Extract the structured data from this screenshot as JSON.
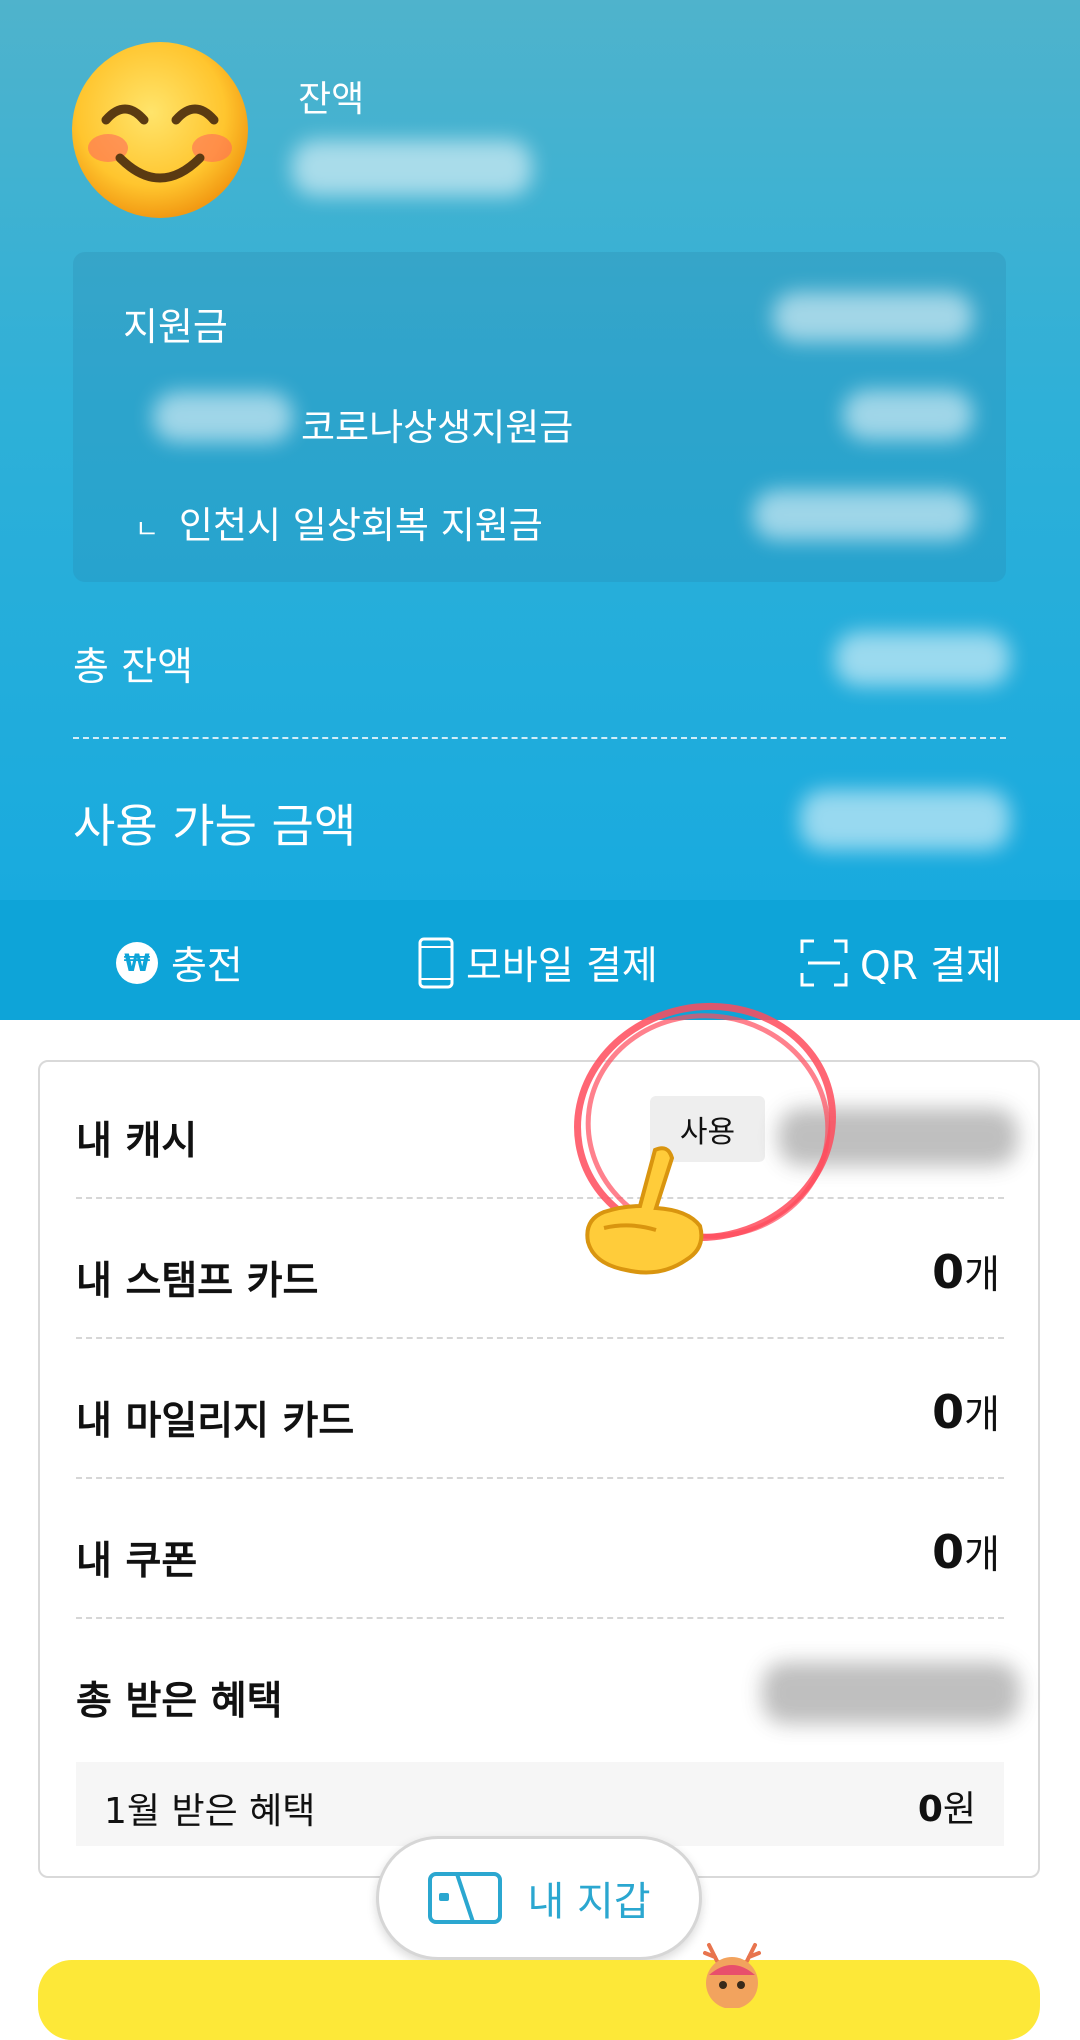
{
  "header": {
    "balance_label": "잔액"
  },
  "subsidy": {
    "title": "지원금",
    "row1_label": "코로나상생지원금",
    "row2_label": "인천시 일상회복 지원금",
    "row2_prefix": "ㄴ"
  },
  "totals": {
    "total_balance_label": "총 잔액",
    "available_label": "사용 가능 금액"
  },
  "actions": {
    "charge": "충전",
    "charge_symbol": "₩",
    "mobile_pay": "모바일 결제",
    "qr_pay": "QR 결제"
  },
  "wallet": {
    "cash_label": "내 캐시",
    "use_button": "사용",
    "stamp_label": "내 스탬프 카드",
    "stamp_count": "0",
    "mileage_label": "내 마일리지 카드",
    "mileage_count": "0",
    "coupon_label": "내 쿠폰",
    "coupon_count": "0",
    "unit_count": "개",
    "benefit_label": "총 받은 혜택",
    "month_benefit_label": "1월 받은 혜택",
    "month_benefit_value": "0",
    "unit_won": "원"
  },
  "bottom": {
    "wallet_button": "내 지갑"
  },
  "colors": {
    "accent": "#13a9e0",
    "wallet_text": "#2ba7d0",
    "banner": "#fde838",
    "annotation": "#ff4b5c"
  }
}
